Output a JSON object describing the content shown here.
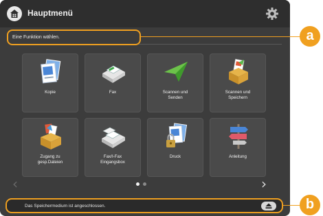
{
  "header": {
    "title": "Hauptmenü",
    "home_icon": "home-icon",
    "settings_icon": "gear-icon"
  },
  "message": {
    "text": "Eine Funktion wählen."
  },
  "tiles": [
    {
      "id": "kopie",
      "label": "Kopie",
      "icon": "copy-icon"
    },
    {
      "id": "fax",
      "label": "Fax",
      "icon": "fax-icon"
    },
    {
      "id": "scannen-senden",
      "label": "Scannen und\nSenden",
      "icon": "paper-plane-icon"
    },
    {
      "id": "scannen-speichern",
      "label": "Scannen und\nSpeichern",
      "icon": "storage-box-icon"
    },
    {
      "id": "zugang-dateien",
      "label": "Zugang zu\ngesp.Dateien",
      "icon": "file-box-icon"
    },
    {
      "id": "fax-eingangsbox",
      "label": "Fax/I-Fax\nEingangsbox",
      "icon": "fax-inbox-icon"
    },
    {
      "id": "druck",
      "label": "Druck",
      "icon": "secure-print-icon"
    },
    {
      "id": "anleitung",
      "label": "Anleitung",
      "icon": "signpost-icon"
    }
  ],
  "pagination": {
    "current_page": 1,
    "total_pages": 2
  },
  "status": {
    "text": "Das Speichermedium ist angeschlossen.",
    "eject_icon": "eject-icon"
  },
  "callouts": [
    "a",
    "b"
  ],
  "colors": {
    "accent": "#f0a020",
    "screen_bg": "#3c3c3c",
    "tile_bg": "#4a4a4a"
  }
}
